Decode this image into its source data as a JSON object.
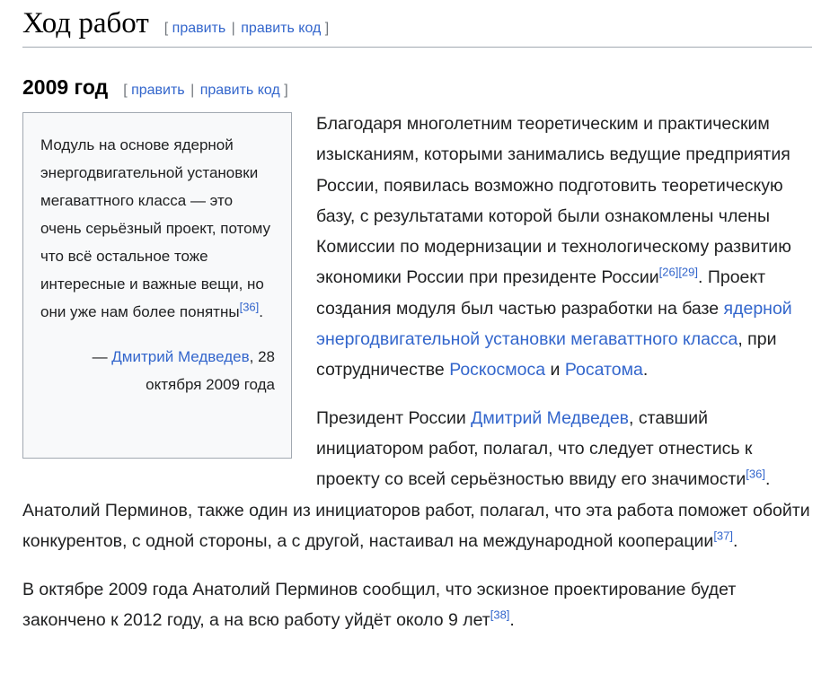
{
  "section": {
    "title": "Ход работ",
    "edit": "править",
    "edit_code": "править код"
  },
  "subsection": {
    "title": "2009 год",
    "edit": "править",
    "edit_code": "править код"
  },
  "quote": {
    "text": "Модуль на основе ядерной энергодвигательной установки мегаваттного класса — это очень серьёзный проект, потому что всё остальное тоже интересные и важные вещи, но они уже нам более понятны",
    "ref": "[36]",
    "cite_dash": "— ",
    "cite_author": "Дмитрий Медведев",
    "cite_date": ", 28 октября 2009 года"
  },
  "p1": {
    "t1": "Благодаря многолетним теоретическим и практическим изысканиям, которыми занимались ведущие предприятия России, появилась возможно подготовить теоретическую базу, с результатами которой были ознакомлены члены Комиссии по модернизации и технологическому развитию экономики России при президенте России",
    "ref1": "[26]",
    "ref2": "[29]",
    "t2": ". Проект создания модуля был частью разработки на базе ",
    "link1": "ядерной энергодвигательной установки мегаваттного класса",
    "t3": ", при сотрудничестве ",
    "link2": "Роскосмоса",
    "t4": " и ",
    "link3": "Росатома",
    "t5": "."
  },
  "p2": {
    "t1": "Президент России ",
    "link1": "Дмитрий Медведев",
    "t2": ", ставший инициатором работ, полагал, что следует отнестись к проекту со всей серьёзностью ввиду его значимости",
    "ref1": "[36]",
    "t3": ". Анатолий Перминов, также один из инициаторов работ, полагал, что эта работа поможет обойти конкурентов, с одной стороны, а с другой, настаивал на международной кооперации",
    "ref2": "[37]",
    "t4": "."
  },
  "p3": {
    "t1": "В октябре 2009 года Анатолий Перминов сообщил, что эскизное проектирование будет закончено к 2012 году, а на всю работу уйдёт около 9 лет",
    "ref1": "[38]",
    "t2": "."
  }
}
